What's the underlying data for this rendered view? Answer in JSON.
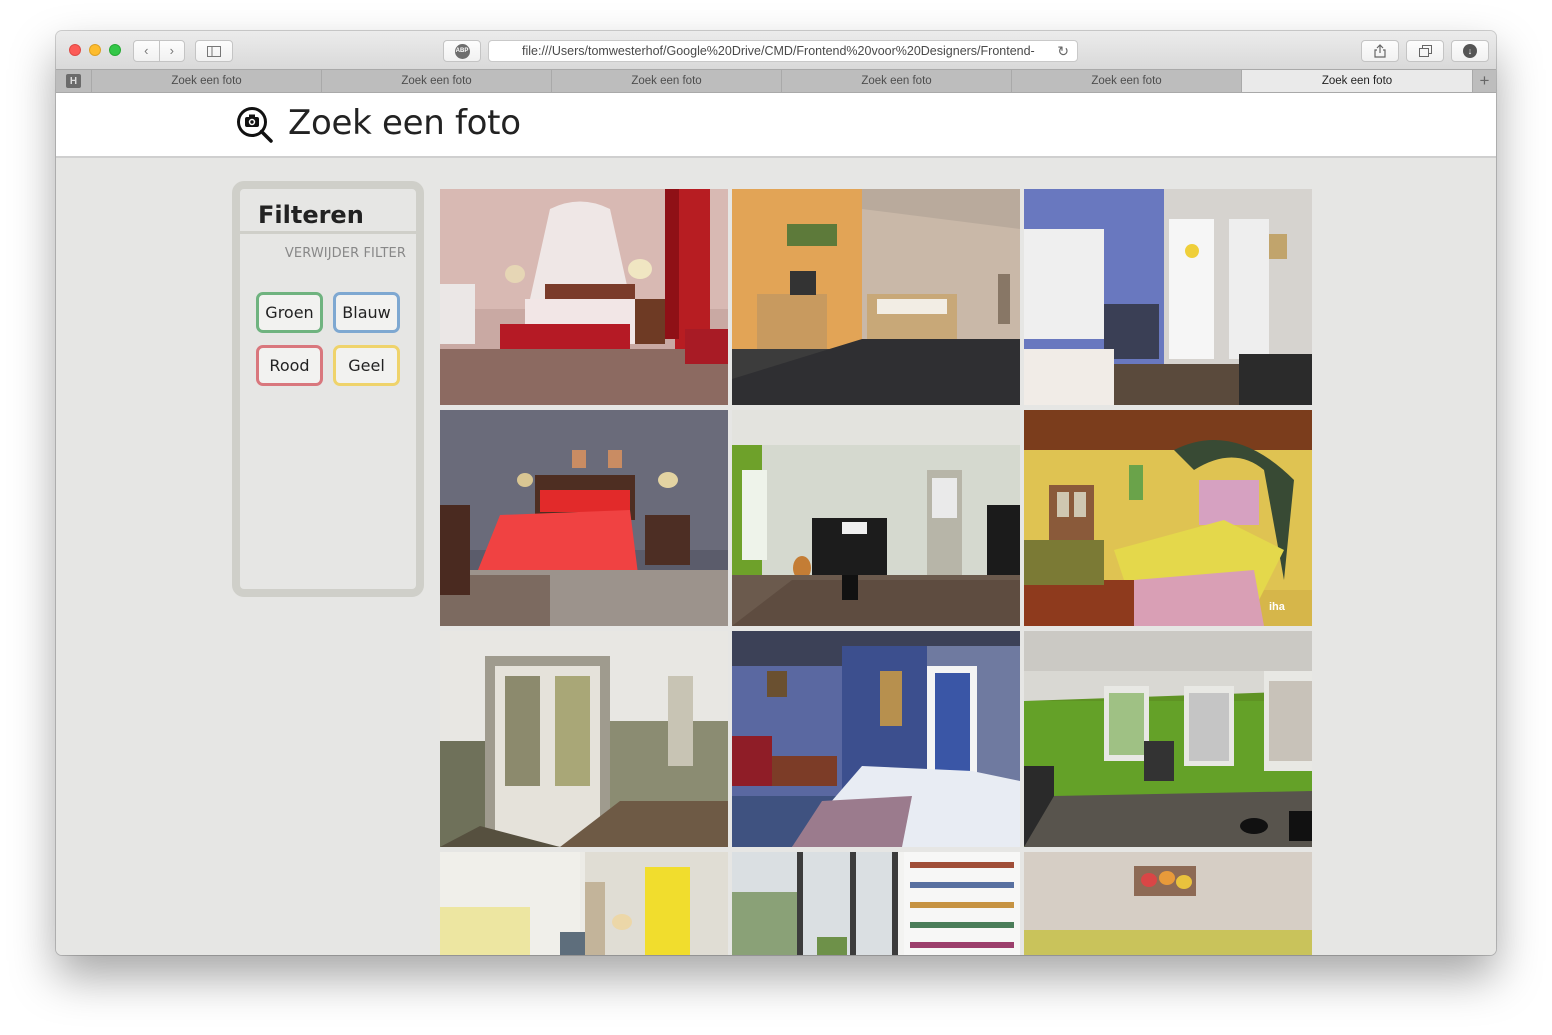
{
  "browser": {
    "url": "file:///Users/tomwesterhof/Google%20Drive/CMD/Frontend%20voor%20Designers/Frontend-",
    "adblock_label": "ABP",
    "tabs": [
      "Zoek een foto",
      "Zoek een foto",
      "Zoek een foto",
      "Zoek een foto",
      "Zoek een foto",
      "Zoek een foto"
    ],
    "active_tab_index": 5,
    "pinned_tab_label": "H"
  },
  "header": {
    "title": "Zoek een foto"
  },
  "filter": {
    "title": "Filteren",
    "clear_label": "VERWIJDER FILTER",
    "chips": [
      {
        "label": "Groen",
        "color": "#6fb37f"
      },
      {
        "label": "Blauw",
        "color": "#7ea8d1"
      },
      {
        "label": "Rood",
        "color": "#d9777d"
      },
      {
        "label": "Geel",
        "color": "#efd36b"
      }
    ]
  },
  "photos": [
    {
      "subject": "bedroom with red bedspread and canopy",
      "watermark": ""
    },
    {
      "subject": "orange bedroom with wooden dresser",
      "watermark": ""
    },
    {
      "subject": "blue room with white door and cabinet",
      "watermark": ""
    },
    {
      "subject": "bedroom with red duvet",
      "watermark": ""
    },
    {
      "subject": "green room with piano",
      "watermark": ""
    },
    {
      "subject": "yellow bedroom with canopy bed",
      "watermark": "iha"
    },
    {
      "subject": "hallway with double glass doors",
      "watermark": ""
    },
    {
      "subject": "blue bedroom with plaid bed",
      "watermark": ""
    },
    {
      "subject": "green room with windows",
      "watermark": ""
    },
    {
      "subject": "bright room with yellow wall",
      "watermark": ""
    },
    {
      "subject": "room with large windows and bookshelf",
      "watermark": ""
    },
    {
      "subject": "room with painting of tulips",
      "watermark": ""
    }
  ]
}
